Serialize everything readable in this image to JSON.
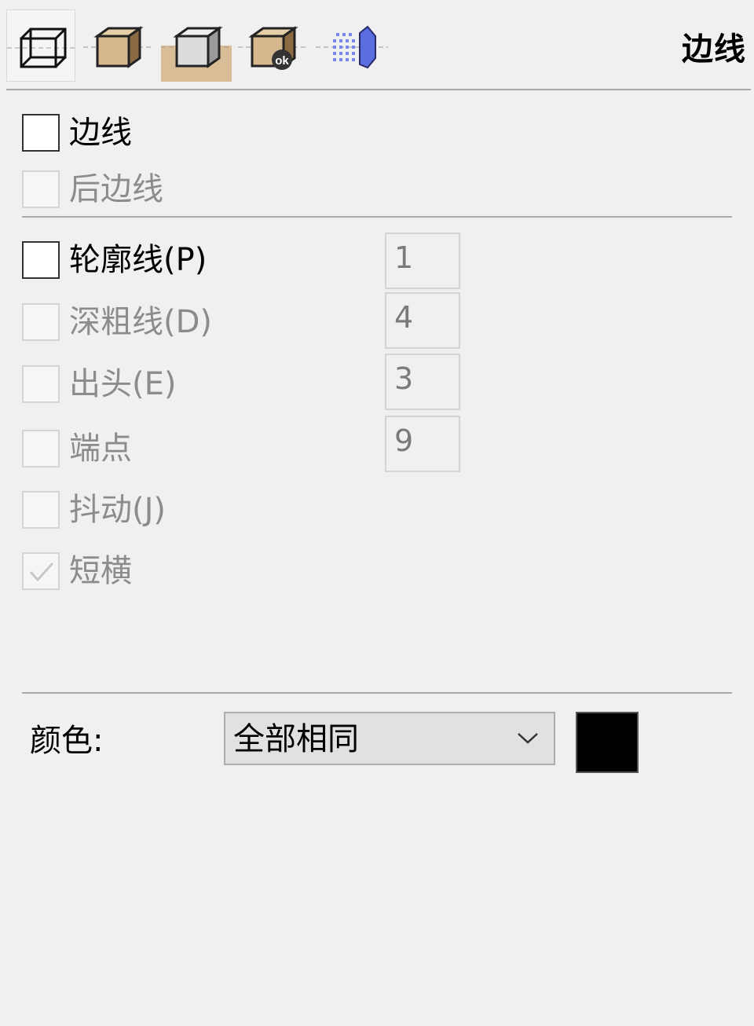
{
  "header": {
    "title": "边线",
    "style_buttons": [
      {
        "icon": "wireframe-icon",
        "selected": true
      },
      {
        "icon": "shaded-box-icon",
        "selected": false
      },
      {
        "icon": "hidden-line-box-icon",
        "selected": false,
        "active": true
      },
      {
        "icon": "shaded-box-ok-icon",
        "selected": false
      },
      {
        "icon": "x-ray-box-icon",
        "selected": false
      }
    ]
  },
  "edges": {
    "edges_label": "边线",
    "edges_checked": false,
    "back_edges_label": "后边线",
    "back_edges_checked": false,
    "back_edges_enabled": false
  },
  "options": {
    "profiles": {
      "label": "轮廓线(P)",
      "checked": false,
      "enabled": true,
      "value": "1"
    },
    "depth_cue": {
      "label": "深粗线(D)",
      "checked": false,
      "enabled": false,
      "value": "4"
    },
    "extension": {
      "label": "出头(E)",
      "checked": false,
      "enabled": false,
      "value": "3"
    },
    "endpoints": {
      "label": "端点",
      "checked": false,
      "enabled": false,
      "value": "9"
    },
    "jitter": {
      "label": "抖动(J)",
      "checked": false,
      "enabled": false
    },
    "dashes": {
      "label": "短横",
      "checked": true,
      "enabled": false
    }
  },
  "color": {
    "label": "颜色:",
    "selected": "全部相同",
    "swatch": "#000000"
  }
}
